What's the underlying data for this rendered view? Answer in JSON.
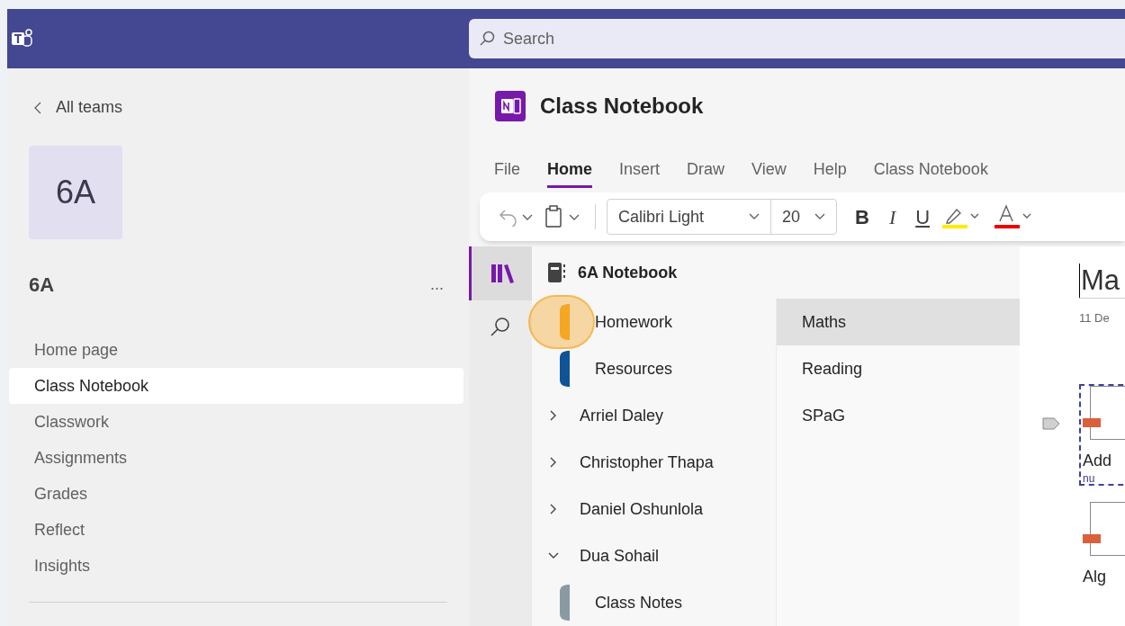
{
  "search": {
    "placeholder": "Search"
  },
  "team": {
    "back": "All teams",
    "tile": "6A",
    "name": "6A",
    "more": "...",
    "nav": [
      {
        "label": "Home page",
        "selected": false
      },
      {
        "label": "Class Notebook",
        "selected": true
      },
      {
        "label": "Classwork",
        "selected": false
      },
      {
        "label": "Assignments",
        "selected": false
      },
      {
        "label": "Grades",
        "selected": false
      },
      {
        "label": "Reflect",
        "selected": false
      },
      {
        "label": "Insights",
        "selected": false
      }
    ]
  },
  "app": {
    "title": "Class Notebook",
    "ribbon_tabs": [
      {
        "label": "File",
        "selected": false
      },
      {
        "label": "Home",
        "selected": true
      },
      {
        "label": "Insert",
        "selected": false
      },
      {
        "label": "Draw",
        "selected": false
      },
      {
        "label": "View",
        "selected": false
      },
      {
        "label": "Help",
        "selected": false
      },
      {
        "label": "Class Notebook",
        "selected": false
      }
    ],
    "font": "Calibri Light",
    "size": "20",
    "toolbar": [
      "B",
      "I",
      "U"
    ]
  },
  "notebook": {
    "title": "6A Notebook",
    "sections": [
      {
        "kind": "section",
        "label": "Homework",
        "color": "#f5a623",
        "selected": true
      },
      {
        "kind": "section",
        "label": "Resources",
        "color": "#0f5496",
        "selected": false
      },
      {
        "kind": "group",
        "label": "Arriel Daley",
        "expanded": false
      },
      {
        "kind": "group",
        "label": "Christopher Thapa",
        "expanded": false
      },
      {
        "kind": "group",
        "label": "Daniel Oshunlola",
        "expanded": false
      },
      {
        "kind": "group",
        "label": "Dua Sohail",
        "expanded": true,
        "children": [
          {
            "kind": "section",
            "label": "Class Notes",
            "color": "#8a9aa3",
            "selected": false
          }
        ]
      }
    ],
    "pages": [
      {
        "label": "Maths",
        "selected": true
      },
      {
        "label": "Reading",
        "selected": false
      },
      {
        "label": "SPaG",
        "selected": false
      }
    ]
  },
  "canvas": {
    "title": "Ma",
    "date": "11 De",
    "items": [
      {
        "caption": "Add",
        "note": "nu"
      },
      {
        "caption": "Alg"
      }
    ]
  }
}
